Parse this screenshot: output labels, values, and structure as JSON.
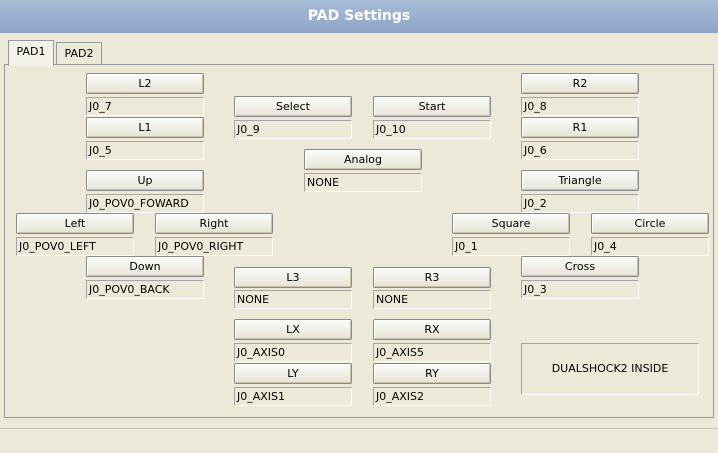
{
  "window": {
    "title": "PAD Settings"
  },
  "tabs": [
    "PAD1",
    "PAD2"
  ],
  "controls": {
    "l2": {
      "label": "L2",
      "value": "J0_7"
    },
    "l1": {
      "label": "L1",
      "value": "J0_5"
    },
    "up": {
      "label": "Up",
      "value": "J0_POV0_FOWARD"
    },
    "left": {
      "label": "Left",
      "value": "J0_POV0_LEFT"
    },
    "right": {
      "label": "Right",
      "value": "J0_POV0_RIGHT"
    },
    "down": {
      "label": "Down",
      "value": "J0_POV0_BACK"
    },
    "select": {
      "label": "Select",
      "value": "J0_9"
    },
    "start": {
      "label": "Start",
      "value": "J0_10"
    },
    "analog": {
      "label": "Analog",
      "value": "NONE"
    },
    "l3": {
      "label": "L3",
      "value": "NONE"
    },
    "r3": {
      "label": "R3",
      "value": "NONE"
    },
    "lx": {
      "label": "LX",
      "value": "J0_AXIS0"
    },
    "rx": {
      "label": "RX",
      "value": "J0_AXIS5"
    },
    "ly": {
      "label": "LY",
      "value": "J0_AXIS1"
    },
    "ry": {
      "label": "RY",
      "value": "J0_AXIS2"
    },
    "r2": {
      "label": "R2",
      "value": "J0_8"
    },
    "r1": {
      "label": "R1",
      "value": "J0_6"
    },
    "triangle": {
      "label": "Triangle",
      "value": "J0_2"
    },
    "square": {
      "label": "Square",
      "value": "J0_1"
    },
    "circle": {
      "label": "Circle",
      "value": "J0_4"
    },
    "cross": {
      "label": "Cross",
      "value": "J0_3"
    }
  },
  "device_badge": "DUALSHOCK2 INSIDE"
}
